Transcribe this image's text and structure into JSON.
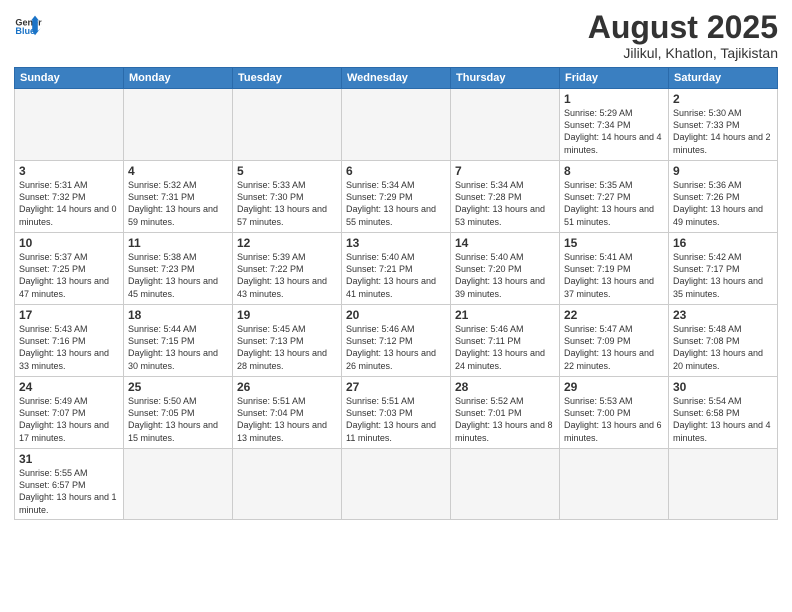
{
  "logo": {
    "general": "General",
    "blue": "Blue"
  },
  "title": "August 2025",
  "subtitle": "Jilikul, Khatlon, Tajikistan",
  "weekdays": [
    "Sunday",
    "Monday",
    "Tuesday",
    "Wednesday",
    "Thursday",
    "Friday",
    "Saturday"
  ],
  "weeks": [
    [
      {
        "day": "",
        "info": ""
      },
      {
        "day": "",
        "info": ""
      },
      {
        "day": "",
        "info": ""
      },
      {
        "day": "",
        "info": ""
      },
      {
        "day": "",
        "info": ""
      },
      {
        "day": "1",
        "info": "Sunrise: 5:29 AM\nSunset: 7:34 PM\nDaylight: 14 hours\nand 4 minutes."
      },
      {
        "day": "2",
        "info": "Sunrise: 5:30 AM\nSunset: 7:33 PM\nDaylight: 14 hours\nand 2 minutes."
      }
    ],
    [
      {
        "day": "3",
        "info": "Sunrise: 5:31 AM\nSunset: 7:32 PM\nDaylight: 14 hours\nand 0 minutes."
      },
      {
        "day": "4",
        "info": "Sunrise: 5:32 AM\nSunset: 7:31 PM\nDaylight: 13 hours\nand 59 minutes."
      },
      {
        "day": "5",
        "info": "Sunrise: 5:33 AM\nSunset: 7:30 PM\nDaylight: 13 hours\nand 57 minutes."
      },
      {
        "day": "6",
        "info": "Sunrise: 5:34 AM\nSunset: 7:29 PM\nDaylight: 13 hours\nand 55 minutes."
      },
      {
        "day": "7",
        "info": "Sunrise: 5:34 AM\nSunset: 7:28 PM\nDaylight: 13 hours\nand 53 minutes."
      },
      {
        "day": "8",
        "info": "Sunrise: 5:35 AM\nSunset: 7:27 PM\nDaylight: 13 hours\nand 51 minutes."
      },
      {
        "day": "9",
        "info": "Sunrise: 5:36 AM\nSunset: 7:26 PM\nDaylight: 13 hours\nand 49 minutes."
      }
    ],
    [
      {
        "day": "10",
        "info": "Sunrise: 5:37 AM\nSunset: 7:25 PM\nDaylight: 13 hours\nand 47 minutes."
      },
      {
        "day": "11",
        "info": "Sunrise: 5:38 AM\nSunset: 7:23 PM\nDaylight: 13 hours\nand 45 minutes."
      },
      {
        "day": "12",
        "info": "Sunrise: 5:39 AM\nSunset: 7:22 PM\nDaylight: 13 hours\nand 43 minutes."
      },
      {
        "day": "13",
        "info": "Sunrise: 5:40 AM\nSunset: 7:21 PM\nDaylight: 13 hours\nand 41 minutes."
      },
      {
        "day": "14",
        "info": "Sunrise: 5:40 AM\nSunset: 7:20 PM\nDaylight: 13 hours\nand 39 minutes."
      },
      {
        "day": "15",
        "info": "Sunrise: 5:41 AM\nSunset: 7:19 PM\nDaylight: 13 hours\nand 37 minutes."
      },
      {
        "day": "16",
        "info": "Sunrise: 5:42 AM\nSunset: 7:17 PM\nDaylight: 13 hours\nand 35 minutes."
      }
    ],
    [
      {
        "day": "17",
        "info": "Sunrise: 5:43 AM\nSunset: 7:16 PM\nDaylight: 13 hours\nand 33 minutes."
      },
      {
        "day": "18",
        "info": "Sunrise: 5:44 AM\nSunset: 7:15 PM\nDaylight: 13 hours\nand 30 minutes."
      },
      {
        "day": "19",
        "info": "Sunrise: 5:45 AM\nSunset: 7:13 PM\nDaylight: 13 hours\nand 28 minutes."
      },
      {
        "day": "20",
        "info": "Sunrise: 5:46 AM\nSunset: 7:12 PM\nDaylight: 13 hours\nand 26 minutes."
      },
      {
        "day": "21",
        "info": "Sunrise: 5:46 AM\nSunset: 7:11 PM\nDaylight: 13 hours\nand 24 minutes."
      },
      {
        "day": "22",
        "info": "Sunrise: 5:47 AM\nSunset: 7:09 PM\nDaylight: 13 hours\nand 22 minutes."
      },
      {
        "day": "23",
        "info": "Sunrise: 5:48 AM\nSunset: 7:08 PM\nDaylight: 13 hours\nand 20 minutes."
      }
    ],
    [
      {
        "day": "24",
        "info": "Sunrise: 5:49 AM\nSunset: 7:07 PM\nDaylight: 13 hours\nand 17 minutes."
      },
      {
        "day": "25",
        "info": "Sunrise: 5:50 AM\nSunset: 7:05 PM\nDaylight: 13 hours\nand 15 minutes."
      },
      {
        "day": "26",
        "info": "Sunrise: 5:51 AM\nSunset: 7:04 PM\nDaylight: 13 hours\nand 13 minutes."
      },
      {
        "day": "27",
        "info": "Sunrise: 5:51 AM\nSunset: 7:03 PM\nDaylight: 13 hours\nand 11 minutes."
      },
      {
        "day": "28",
        "info": "Sunrise: 5:52 AM\nSunset: 7:01 PM\nDaylight: 13 hours\nand 8 minutes."
      },
      {
        "day": "29",
        "info": "Sunrise: 5:53 AM\nSunset: 7:00 PM\nDaylight: 13 hours\nand 6 minutes."
      },
      {
        "day": "30",
        "info": "Sunrise: 5:54 AM\nSunset: 6:58 PM\nDaylight: 13 hours\nand 4 minutes."
      }
    ],
    [
      {
        "day": "31",
        "info": "Sunrise: 5:55 AM\nSunset: 6:57 PM\nDaylight: 13 hours\nand 1 minute."
      },
      {
        "day": "",
        "info": ""
      },
      {
        "day": "",
        "info": ""
      },
      {
        "day": "",
        "info": ""
      },
      {
        "day": "",
        "info": ""
      },
      {
        "day": "",
        "info": ""
      },
      {
        "day": "",
        "info": ""
      }
    ]
  ]
}
